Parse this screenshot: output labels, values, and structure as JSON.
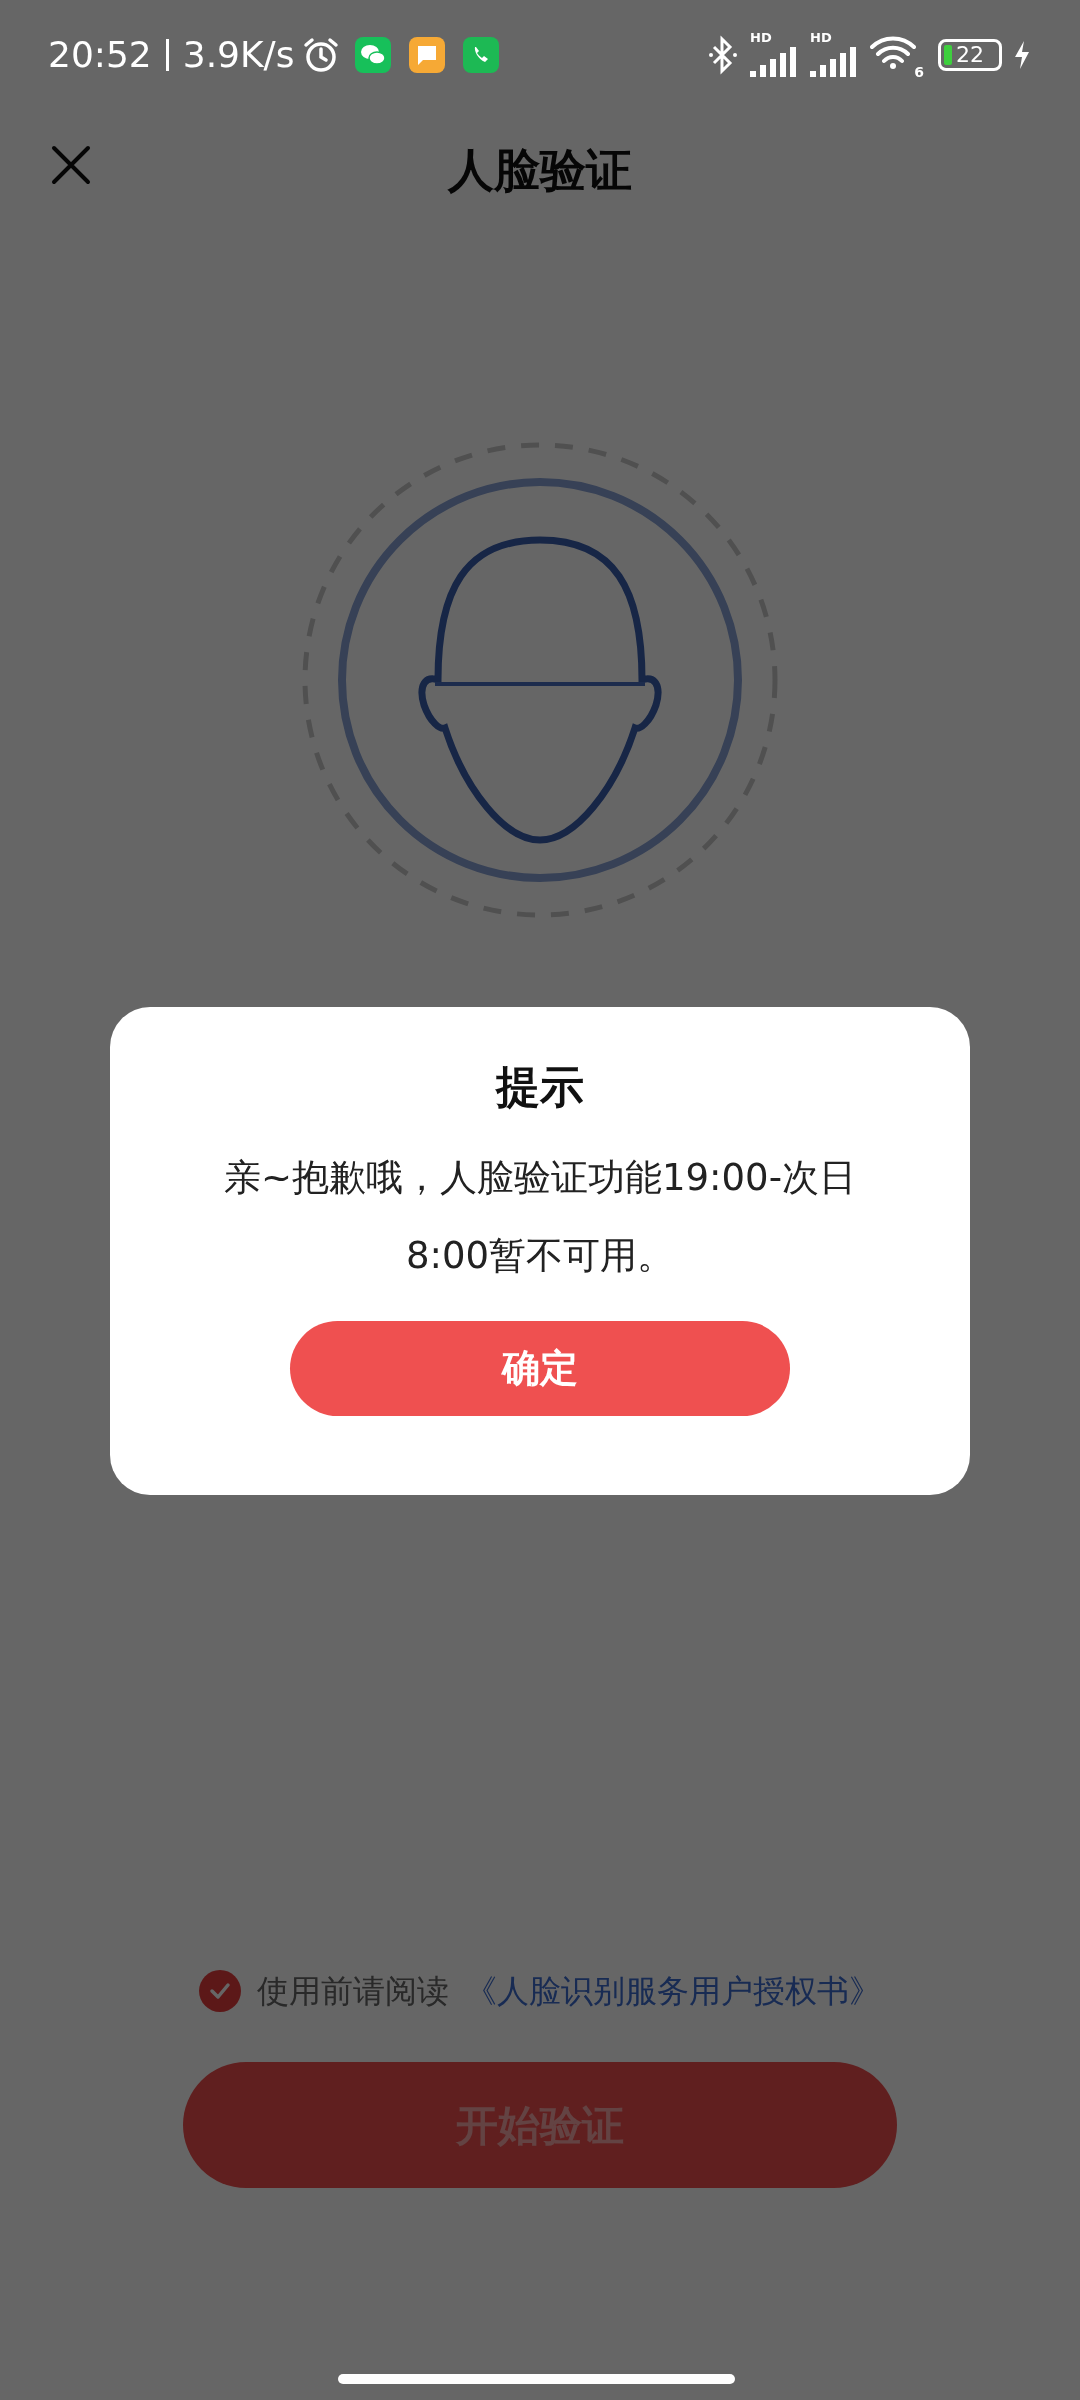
{
  "status_bar": {
    "time": "20:52",
    "speed": "3.9K/s",
    "signal_labels": [
      "HD",
      "HD"
    ],
    "wifi_label": "6",
    "battery": "22"
  },
  "header": {
    "title": "人脸验证"
  },
  "consent": {
    "checked": true,
    "prefix": "使用前请阅读",
    "link": "《人脸识别服务用户授权书》"
  },
  "start_button": {
    "label": "开始验证"
  },
  "dialog": {
    "title": "提示",
    "message": "亲~抱歉哦，人脸验证功能19:00-次日8:00暂不可用。",
    "button": "确定"
  }
}
